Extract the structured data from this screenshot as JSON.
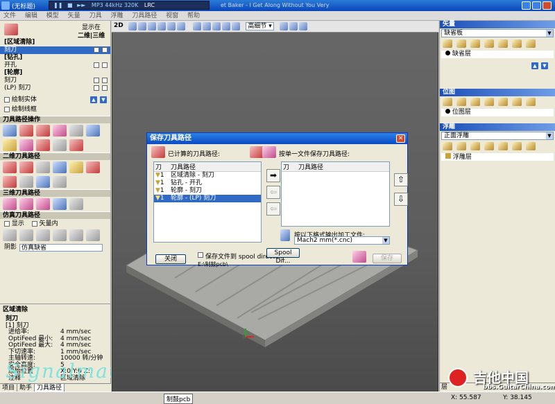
{
  "title": "(无标题)",
  "media": {
    "now_playing": "MP3 44kHz 320K",
    "lrc": "LRC",
    "song": "et Baker - I Get Along Without You Very"
  },
  "menu": [
    "文件",
    "编辑",
    "模型",
    "矢量",
    "刀具",
    "浮雕",
    "刀具路径",
    "视窗",
    "帮助"
  ],
  "left": {
    "show_in": "显示在",
    "two_three": "二维|三维",
    "toolpaths": [
      {
        "group": "[区域清除]",
        "items": [
          {
            "name": "刻刀",
            "selected": true
          }
        ]
      },
      {
        "group": "[钻孔]",
        "items": [
          {
            "name": "开孔"
          }
        ]
      },
      {
        "group": "[轮廓]",
        "items": [
          {
            "name": "刻刀"
          },
          {
            "name": "(LP) 刻刀"
          }
        ]
      }
    ],
    "draw_solid": "绘制实体",
    "draw_wireframe": "绘制线框",
    "sec_ops": "刀具路径操作",
    "sec_2d": "二维刀具路径",
    "sec_3d": "三维刀具路径",
    "sec_sim": "仿真刀具路径",
    "sim_show": "显示",
    "sim_vector": "矢量内",
    "shade_label": "阴影",
    "shade_value": "仿真缺省"
  },
  "props": {
    "header": "区域清除",
    "tool": "刻刀",
    "tool_id": "[1] 刻刀",
    "rows": [
      [
        "进给率:",
        "4 mm/sec"
      ],
      [
        "OptiFeed 最小:",
        "4 mm/sec"
      ],
      [
        "OptiFeed 最大:",
        "4 mm/sec"
      ],
      [
        "下切速率:",
        "1 mm/sec"
      ],
      [
        "主轴转速:",
        "10000 转/分钟"
      ],
      [
        "安全高度:",
        "5"
      ],
      [
        "原始位置",
        "X:0 Y:0 Z:"
      ],
      [
        "注释",
        "区域清除"
      ]
    ]
  },
  "bottom_tabs": [
    "项目",
    "助手",
    "刀具路径"
  ],
  "watermark": "Signalman",
  "view": {
    "mode_2d": "2D",
    "quality": "高细节"
  },
  "right": {
    "vector": {
      "header": "矢量",
      "layer_select": "缺省板",
      "layer_item": "缺省层"
    },
    "bitmap": {
      "header": "位图",
      "layer_item": "位图层"
    },
    "relief": {
      "header": "浮雕",
      "layer_select": "正面浮雕",
      "layer_item": "浮雕层"
    },
    "tab_label": "层"
  },
  "dialog": {
    "title": "保存刀具路径",
    "computed_label": "已计算的刀具路径:",
    "col_tool": "刀",
    "col_path": "刀具路径",
    "computed": [
      {
        "num": "1",
        "name": "区域清除 - 刻刀"
      },
      {
        "num": "1",
        "name": "钻孔 - 开孔"
      },
      {
        "num": "1",
        "name": "轮廓 - 刻刀"
      },
      {
        "num": "1",
        "name": "轮廓 - (LP) 刻刀",
        "selected": true
      }
    ],
    "save_single_label": "按单一文件保存刀具路径:",
    "output_label": "按以下格式输出加工文件:",
    "format": "Mach2 mm(*.cnc)",
    "close": "关闭",
    "save_to_spool": "保存文件到 spool directory",
    "path": "E:\\制鼓pcb\\",
    "spool_dir": "Spool Dir...",
    "save": "保存"
  },
  "logo": {
    "text": "吉他中国",
    "url": "bbs.GuitarChina.com"
  },
  "status": {
    "taskbar": "制鼓pcb",
    "x": "X: 55.587",
    "y": "Y: 38.145"
  }
}
